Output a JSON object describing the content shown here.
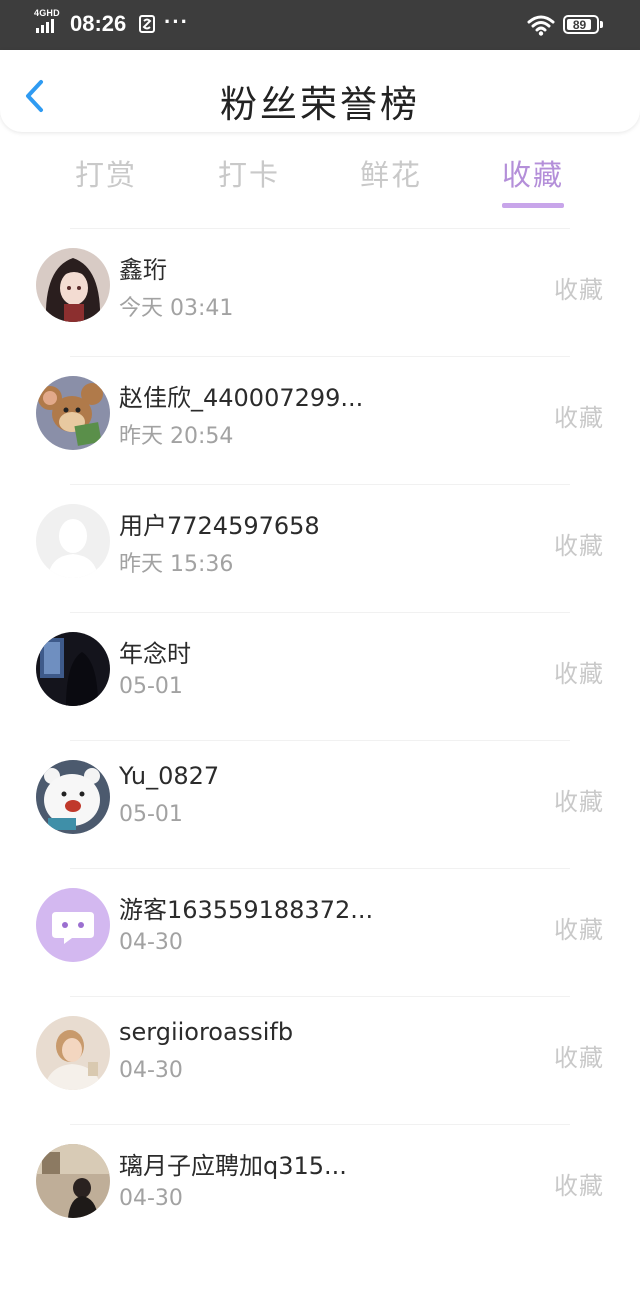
{
  "status_bar": {
    "network": "4GHD",
    "time": "08:26",
    "dots": "···",
    "battery": "89"
  },
  "header": {
    "title": "粉丝荣誉榜"
  },
  "tabs": [
    {
      "label": "打赏",
      "active": false
    },
    {
      "label": "打卡",
      "active": false
    },
    {
      "label": "鲜花",
      "active": false
    },
    {
      "label": "收藏",
      "active": true
    }
  ],
  "fans": [
    {
      "name": "鑫珩",
      "time": "今天 03:41",
      "action": "收藏",
      "avatar": "avatar-girl-dark-hair"
    },
    {
      "name": "赵佳欣_440007299...",
      "time": "昨天 20:54",
      "action": "收藏",
      "avatar": "avatar-cartoon-mouse"
    },
    {
      "name": "用户7724597658",
      "time": "昨天 15:36",
      "action": "收藏",
      "avatar": "avatar-default-user"
    },
    {
      "name": "年念时",
      "time": "05-01",
      "action": "收藏",
      "avatar": "avatar-dark-window"
    },
    {
      "name": "Yu_0827",
      "time": "05-01",
      "action": "收藏",
      "avatar": "avatar-polar-bear"
    },
    {
      "name": "游客163559188372...",
      "time": "04-30",
      "action": "收藏",
      "avatar": "avatar-purple-chat"
    },
    {
      "name": "sergiioroassifb",
      "time": "04-30",
      "action": "收藏",
      "avatar": "avatar-woman-photo"
    },
    {
      "name": "璃月子应聘加q315...",
      "time": "04-30",
      "action": "收藏",
      "avatar": "avatar-room-photo"
    }
  ],
  "colors": {
    "status_bar": "#3d3d3d",
    "accent": "#b48fd9",
    "back_arrow": "#2f9bf2",
    "inactive_tab": "#c9c9c9"
  }
}
